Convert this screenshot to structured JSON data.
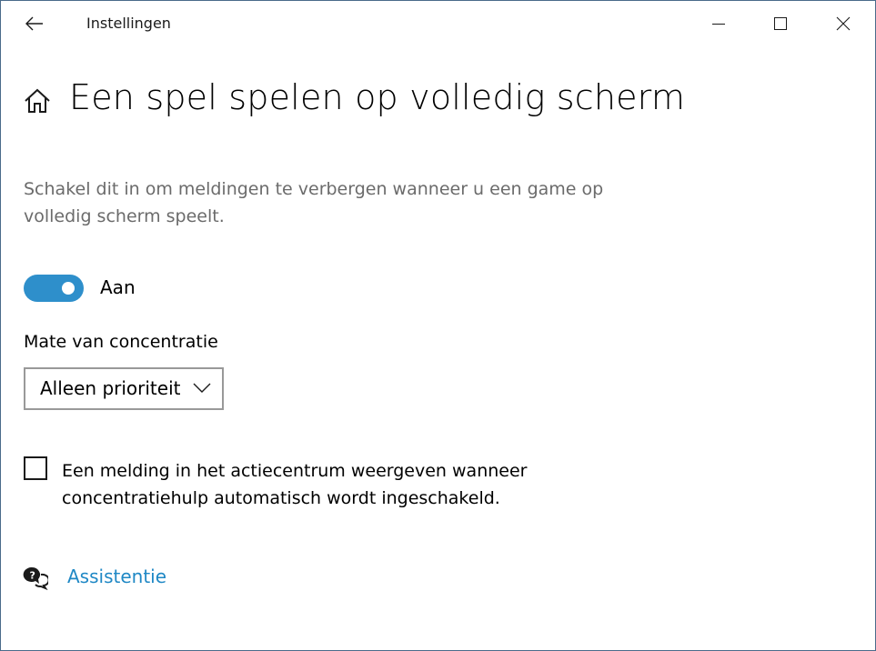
{
  "window": {
    "title": "Instellingen",
    "back_icon": "arrow-left-icon",
    "controls": [
      "minimize-icon",
      "maximize-icon",
      "close-icon"
    ]
  },
  "page": {
    "home_icon": "home-icon",
    "title": "Een spel spelen op volledig scherm",
    "description": "Schakel dit in om meldingen te verbergen wanneer u een game op volledig scherm speelt."
  },
  "toggle": {
    "state": "on",
    "label": "Aan",
    "accent_color": "#2e8fcb"
  },
  "focus_level": {
    "label": "Mate van concentratie",
    "selected": "Alleen prioriteit"
  },
  "notify_checkbox": {
    "checked": false,
    "label": "Een melding in het actiecentrum weergeven wanneer concentratiehulp automatisch wordt ingeschakeld."
  },
  "help": {
    "icon": "help-chat-icon",
    "link_label": "Assistentie",
    "link_color": "#1f88c5"
  }
}
